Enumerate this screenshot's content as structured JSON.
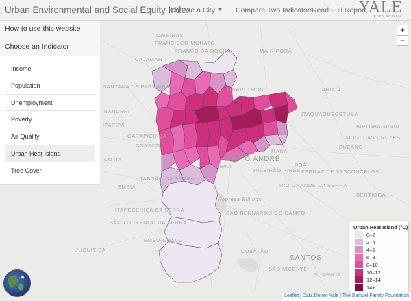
{
  "navbar": {
    "brand": "Urban Environmental and Social Equity Index",
    "choose_city": "Choose a City",
    "compare": "Compare Two Indicators",
    "report": "Read Full Report",
    "logo_word": "YALE",
    "logo_sub": "DATA DRIVEN"
  },
  "panel": {
    "how_to": "How to use this website",
    "choose_indicator": "Choose an Indicator",
    "indicators": [
      {
        "label": "Income",
        "active": false
      },
      {
        "label": "Population",
        "active": false
      },
      {
        "label": "Unemployment",
        "active": false
      },
      {
        "label": "Poverty",
        "active": false
      },
      {
        "label": "Air Quality",
        "active": false
      },
      {
        "label": "Urban Heat Island",
        "active": true
      },
      {
        "label": "Tree Cover",
        "active": false
      }
    ]
  },
  "map": {
    "zoom_in": "+",
    "zoom_out": "−",
    "places": [
      "CAIEIRAS",
      "FRANCISCO MORATO",
      "FRANCO DA ROCHA",
      "MAIRIPORÃ",
      "CAJAMAR",
      "SANTANA DE PARNAÍBA",
      "GUARULHOS",
      "ARUJÁ",
      "ITAQUAQUECETUBA",
      "BARUERI",
      "CARAPICUÍBA",
      "ITAPEVI",
      "OSASCO",
      "SUZANO",
      "POÁ",
      "FERRAZ DE VASCONCELOS",
      "COTIA",
      "TABOÃO DA SERRA",
      "SANTO ANDRÉ",
      "RIO GRANDE DA SERRA",
      "RIBEIRÃO PIRES",
      "MAUÁ",
      "EMBU",
      "ITAPECERICA DA SERRA",
      "SÃO BERNARDO DO CAMPO",
      "SÃO LOURENÇO DA SERRA",
      "JUQUITIBA",
      "SANTOS",
      "Represa Billings",
      "DIADEMA",
      "EMBU-GUAÇU",
      "CUBATÃO",
      "SÃO VICENTE",
      "GUARUJÁ",
      "BERTIOGA",
      "BIRITIBA-MIRIM",
      "MOGI DAS CRUZES"
    ]
  },
  "legend": {
    "title": "Urban Heat Island (°C)",
    "items": [
      {
        "label": "0–2",
        "color": "#ece7f2"
      },
      {
        "label": "2–4",
        "color": "#dbbcdb"
      },
      {
        "label": "4–6",
        "color": "#d594c8"
      },
      {
        "label": "6–8",
        "color": "#e66bb5"
      },
      {
        "label": "8–10",
        "color": "#e14e9b"
      },
      {
        "label": "10–12",
        "color": "#cc2f7b"
      },
      {
        "label": "12–14",
        "color": "#a51c5a"
      },
      {
        "label": "14+",
        "color": "#7a1040"
      }
    ]
  },
  "attribution": {
    "leaflet": "Leaflet",
    "sep": " | ",
    "ddy": "Data Driven Yale",
    "samuel": "The Samuel Family Foundation"
  }
}
